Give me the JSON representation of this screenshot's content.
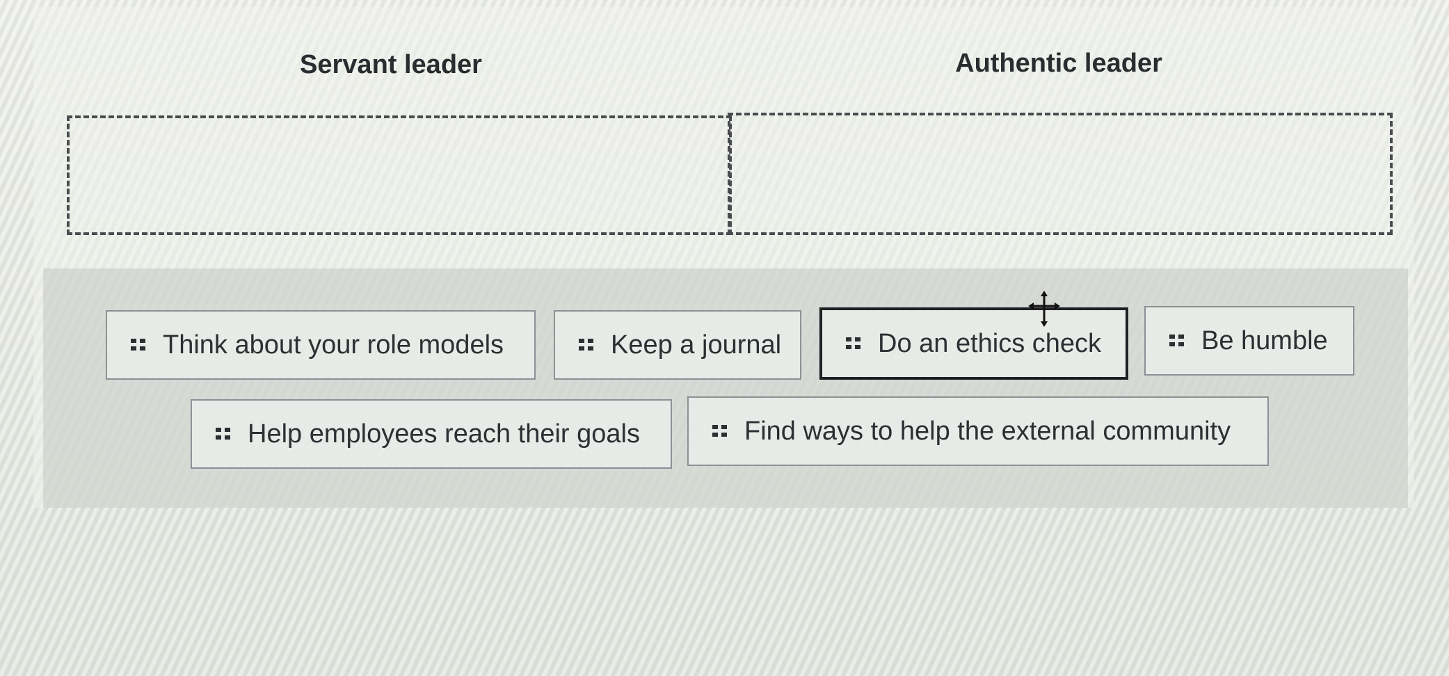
{
  "categories": {
    "servant": "Servant leader",
    "authentic": "Authentic leader"
  },
  "items": [
    "Think about your role models",
    "Keep a journal",
    "Do an ethics check",
    "Be humble",
    "Help employees reach their goals",
    "Find ways to help the external community"
  ],
  "icons": {
    "drag_handle": "drag-handle-icon",
    "cursor": "move-cursor-icon"
  }
}
